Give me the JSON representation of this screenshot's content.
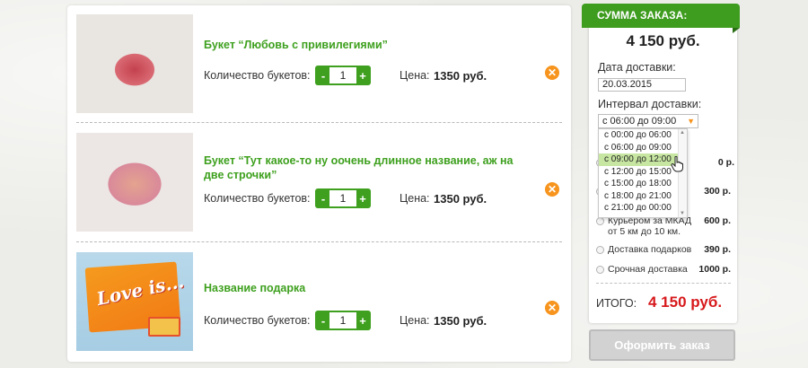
{
  "cart": {
    "items": [
      {
        "title": "Букет “Любовь с привилегиями”",
        "qty_label": "Количество букетов:",
        "qty": "1",
        "minus": "-",
        "plus": "+",
        "price_label": "Цена:",
        "price": "1350 руб."
      },
      {
        "title": "Букет “Тут какое-то ну оочень длинное название, аж на две строчки”",
        "qty_label": "Количество букетов:",
        "qty": "1",
        "minus": "-",
        "plus": "+",
        "price_label": "Цена:",
        "price": "1350 руб."
      },
      {
        "title": "Название подарка",
        "qty_label": "Количество букетов:",
        "qty": "1",
        "minus": "-",
        "plus": "+",
        "price_label": "Цена:",
        "price": "1350 руб.",
        "image_text": "Love is..."
      }
    ],
    "remove_glyph": "✕"
  },
  "summary": {
    "header": "СУММА ЗАКАЗА:",
    "total": "4 150 руб.",
    "date_label": "Дата доставки:",
    "date_value": "20.03.2015",
    "interval_label": "Интервал доставки:",
    "interval_selected": "с 06:00 до 09:00",
    "interval_options": [
      "с 00:00 до 06:00",
      "с 06:00 до 09:00",
      "с 09:00 до 12:00",
      "с 12:00 до 15:00",
      "с 15:00 до 18:00",
      "с 18:00 до 21:00",
      "с 21:00 до 00:00"
    ],
    "interval_hover_index": 2,
    "shipping": [
      {
        "name": "",
        "price": "0 р."
      },
      {
        "name": "",
        "price": "300 р."
      },
      {
        "name": "Курьером за МКАД от 5 км до 10 км.",
        "price": "600 р."
      },
      {
        "name": "Доставка подарков",
        "price": "390 р."
      },
      {
        "name": "Срочная доставка",
        "price": "1000 р."
      }
    ],
    "itogo_label": "ИТОГО:",
    "itogo_value": "4 150 руб.",
    "order_button": "Оформить заказ"
  },
  "colors": {
    "accent_green": "#3ea01e",
    "remove_orange": "#f7941d",
    "total_red": "#d7191c"
  }
}
